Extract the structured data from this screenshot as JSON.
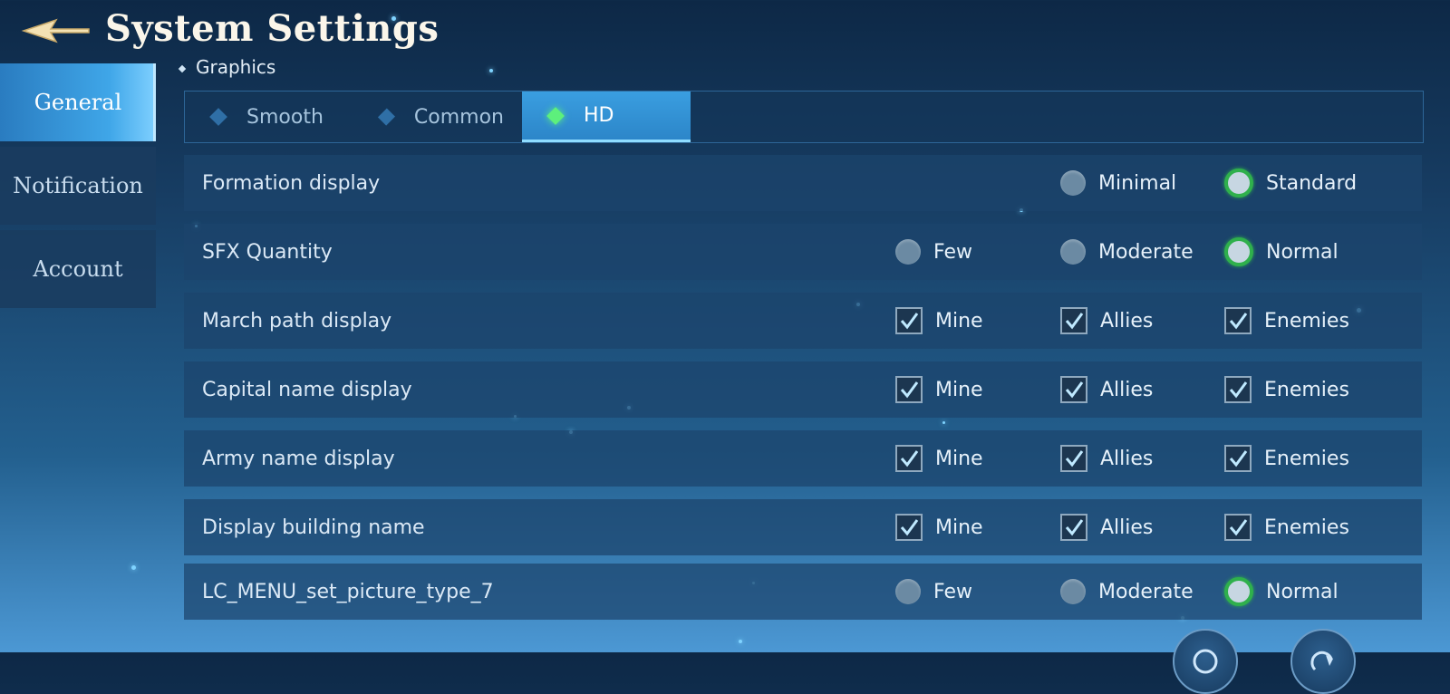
{
  "header": {
    "title": "System Settings"
  },
  "sidebar": {
    "items": [
      {
        "label": "General",
        "active": true
      },
      {
        "label": "Notification",
        "active": false
      },
      {
        "label": "Account",
        "active": false
      }
    ]
  },
  "graphics": {
    "title": "Graphics",
    "options": [
      {
        "label": "Smooth",
        "selected": false
      },
      {
        "label": "Common",
        "selected": false
      },
      {
        "label": "HD",
        "selected": true
      }
    ]
  },
  "settings": [
    {
      "label": "Formation display",
      "type": "radio",
      "options": [
        {
          "label": "Minimal",
          "checked": false
        },
        {
          "label": "Standard",
          "checked": true
        }
      ]
    },
    {
      "label": "SFX Quantity",
      "type": "radio",
      "options": [
        {
          "label": "Few",
          "checked": false
        },
        {
          "label": "Moderate",
          "checked": false
        },
        {
          "label": "Normal",
          "checked": true
        }
      ]
    },
    {
      "label": "March path display",
      "type": "checkbox",
      "options": [
        {
          "label": "Mine",
          "checked": true
        },
        {
          "label": "Allies",
          "checked": true
        },
        {
          "label": "Enemies",
          "checked": true
        }
      ]
    },
    {
      "label": "Capital name display",
      "type": "checkbox",
      "options": [
        {
          "label": "Mine",
          "checked": true
        },
        {
          "label": "Allies",
          "checked": true
        },
        {
          "label": "Enemies",
          "checked": true
        }
      ]
    },
    {
      "label": "Army name display",
      "type": "checkbox",
      "options": [
        {
          "label": "Mine",
          "checked": true
        },
        {
          "label": "Allies",
          "checked": true
        },
        {
          "label": "Enemies",
          "checked": true
        }
      ]
    },
    {
      "label": "Display building name",
      "type": "checkbox",
      "options": [
        {
          "label": "Mine",
          "checked": true
        },
        {
          "label": "Allies",
          "checked": true
        },
        {
          "label": "Enemies",
          "checked": true
        }
      ]
    },
    {
      "label": "LC_MENU_set_picture_type_7",
      "type": "radio",
      "options": [
        {
          "label": "Few",
          "checked": false
        },
        {
          "label": "Moderate",
          "checked": false
        },
        {
          "label": "Normal",
          "checked": true
        }
      ]
    }
  ],
  "colors": {
    "accent": "#3a9ee0",
    "selected_radio": "#2fb04c",
    "hd_diamond": "#5df07c",
    "title_text": "#fbf6ea"
  },
  "icons": {
    "back": "back-arrow-icon",
    "bottom_left": "circle-icon",
    "bottom_right": "refresh-icon"
  }
}
